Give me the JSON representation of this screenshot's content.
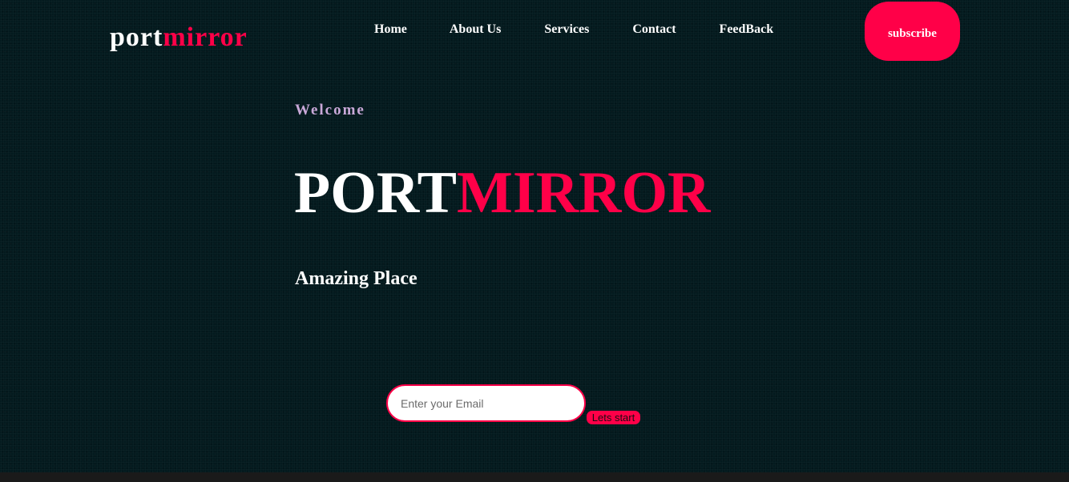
{
  "brand": {
    "name_plain": "port",
    "name_accent": "mirror"
  },
  "nav": {
    "items": [
      {
        "label": "Home"
      },
      {
        "label": "About Us"
      },
      {
        "label": "Services"
      },
      {
        "label": "Contact"
      },
      {
        "label": "FeedBack"
      }
    ]
  },
  "header": {
    "subscribe_label": "subscribe"
  },
  "hero": {
    "welcome": "Welcome",
    "title_plain": "PORT",
    "title_accent": "MIRROR",
    "tagline": "Amazing Place"
  },
  "signup": {
    "email_placeholder": "Enter your Email",
    "email_value": "",
    "button_label": "Lets start"
  },
  "colors": {
    "background": "#031a1e",
    "accent": "#ff0048",
    "welcome_text": "#c9a8d8",
    "footer": "#1a1a1a"
  }
}
